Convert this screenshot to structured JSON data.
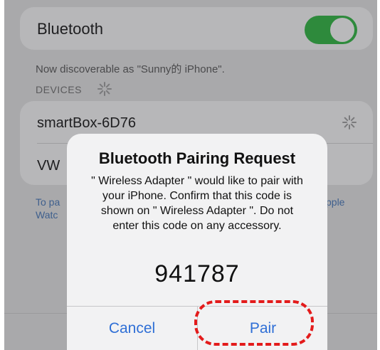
{
  "settings": {
    "bluetooth_label": "Bluetooth",
    "bluetooth_on": true,
    "discoverable_text": "Now discoverable as \"Sunny的 iPhone\".",
    "devices_header": "DEVICES",
    "devices": [
      {
        "name": "smartBox-6D76",
        "status_icon": "loading-spinner-icon"
      },
      {
        "name": "VW"
      }
    ],
    "footer_left": [
      "To pa",
      "Watc"
    ],
    "footer_right": "pple"
  },
  "dialog": {
    "title": "Bluetooth Pairing Request",
    "message": "\" Wireless Adapter \" would like to pair with your iPhone. Confirm that this code is shown on \" Wireless Adapter \". Do not enter this code on any accessory.",
    "code": "941787",
    "cancel_label": "Cancel",
    "pair_label": "Pair"
  },
  "colors": {
    "accent": "#2f6fd6",
    "toggle_on": "#2e8a3c",
    "highlight": "#e31b1b"
  }
}
